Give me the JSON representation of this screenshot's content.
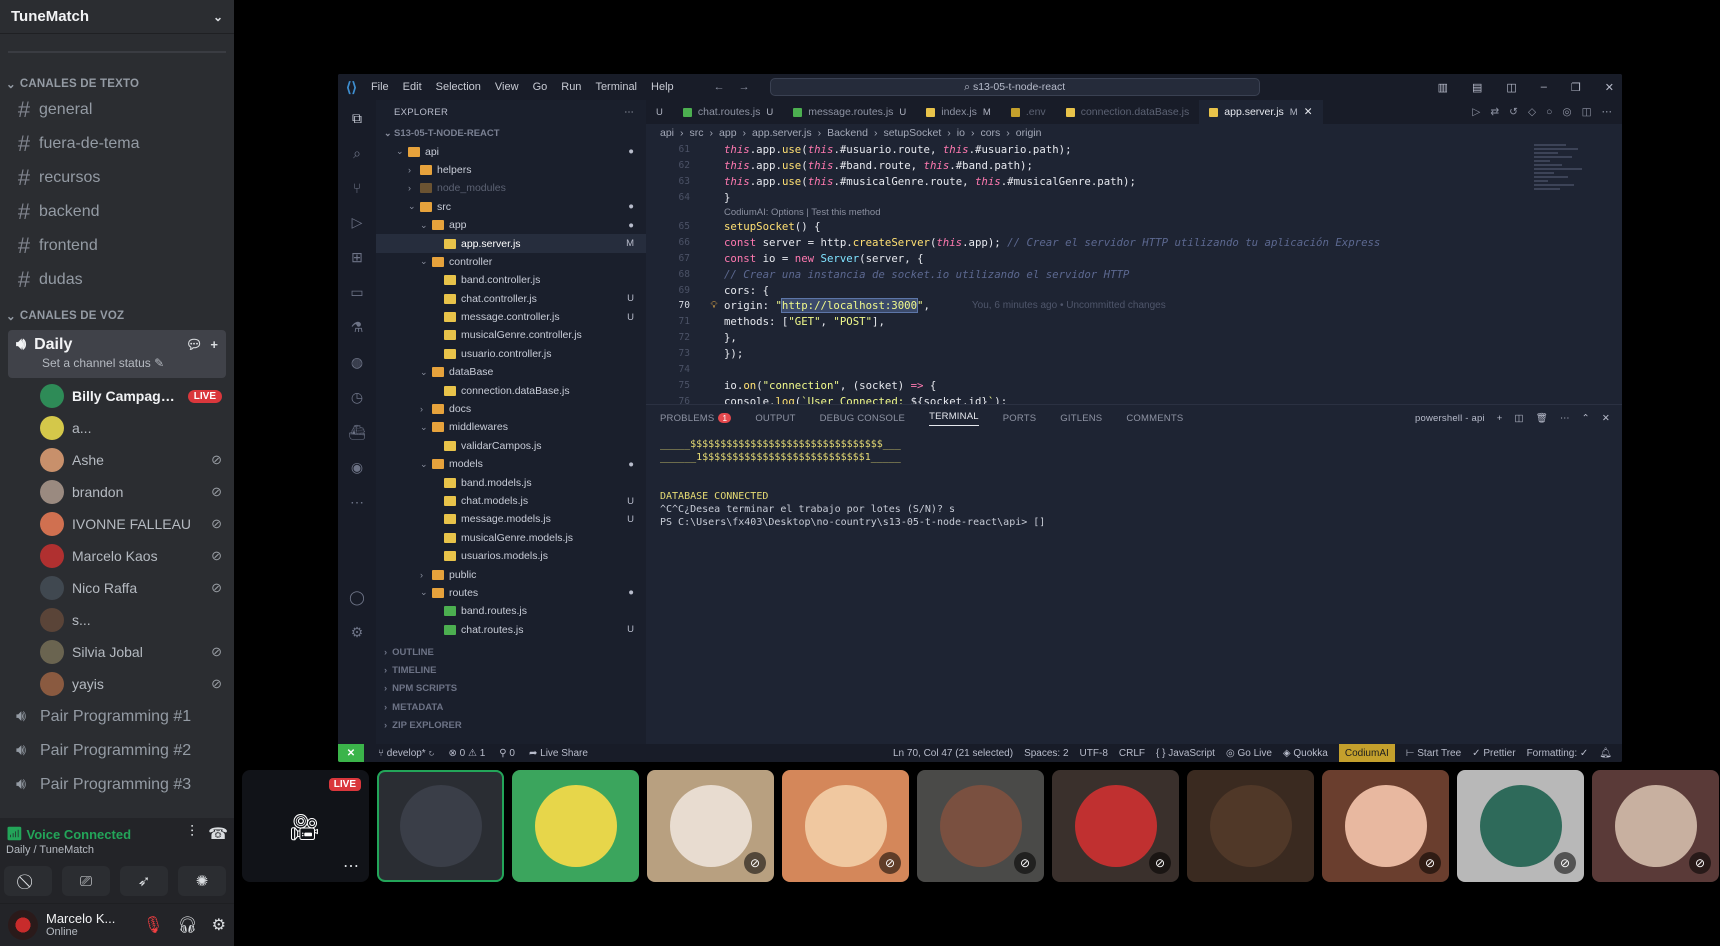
{
  "server": {
    "name": "TuneMatch"
  },
  "text_category": "CANALES DE TEXTO",
  "text_channels": [
    "general",
    "fuera-de-tema",
    "recursos",
    "backend",
    "frontend",
    "dudas"
  ],
  "voice_category": "CANALES DE VOZ",
  "active_voice": {
    "name": "Daily",
    "status": "Set a channel status"
  },
  "voice_members": [
    {
      "name": "Billy Campagno...",
      "live": "LIVE",
      "color": "#2e8b57"
    },
    {
      "name": "a...",
      "color": "#d4c84a"
    },
    {
      "name": "Ashe",
      "muted": true,
      "color": "#c8906b"
    },
    {
      "name": "brandon",
      "muted": true,
      "color": "#9a8a80"
    },
    {
      "name": "IVONNE FALLEAU",
      "muted": true,
      "color": "#d07050"
    },
    {
      "name": "Marcelo Kaos",
      "muted": true,
      "color": "#b03030"
    },
    {
      "name": "Nico Raffa",
      "muted": true,
      "color": "#404850"
    },
    {
      "name": "s...",
      "color": "#5a4438"
    },
    {
      "name": "Silvia Jobal",
      "muted": true,
      "color": "#6a6450"
    },
    {
      "name": "yayis",
      "muted": true,
      "color": "#8a5a40"
    }
  ],
  "other_voice": [
    "Pair Programming #1",
    "Pair Programming #2",
    "Pair Programming #3"
  ],
  "voice_panel": {
    "title": "Voice Connected",
    "subtitle": "Daily / TuneMatch"
  },
  "user": {
    "name": "Marcelo K...",
    "status": "Online"
  },
  "vscode": {
    "menu": [
      "File",
      "Edit",
      "Selection",
      "View",
      "Go",
      "Run",
      "Terminal",
      "Help"
    ],
    "search": "s13-05-t-node-react",
    "explorer_title": "EXPLORER",
    "project": "S13-05-T-NODE-REACT",
    "tree": [
      {
        "label": "api",
        "depth": 1,
        "type": "folder-open",
        "mark": "●"
      },
      {
        "label": "helpers",
        "depth": 2,
        "type": "folder"
      },
      {
        "label": "node_modules",
        "depth": 2,
        "type": "folder",
        "dim": true
      },
      {
        "label": "src",
        "depth": 2,
        "type": "folder-open",
        "mark": "●"
      },
      {
        "label": "app",
        "depth": 3,
        "type": "folder-open",
        "mark": "●"
      },
      {
        "label": "app.server.js",
        "depth": 4,
        "type": "js",
        "mark": "M",
        "sel": true
      },
      {
        "label": "controller",
        "depth": 3,
        "type": "folder-open"
      },
      {
        "label": "band.controller.js",
        "depth": 4,
        "type": "js"
      },
      {
        "label": "chat.controller.js",
        "depth": 4,
        "type": "js",
        "mark": "U"
      },
      {
        "label": "message.controller.js",
        "depth": 4,
        "type": "js",
        "mark": "U"
      },
      {
        "label": "musicalGenre.controller.js",
        "depth": 4,
        "type": "js"
      },
      {
        "label": "usuario.controller.js",
        "depth": 4,
        "type": "js"
      },
      {
        "label": "dataBase",
        "depth": 3,
        "type": "folder-open"
      },
      {
        "label": "connection.dataBase.js",
        "depth": 4,
        "type": "js"
      },
      {
        "label": "docs",
        "depth": 3,
        "type": "folder"
      },
      {
        "label": "middlewares",
        "depth": 3,
        "type": "folder-open"
      },
      {
        "label": "validarCampos.js",
        "depth": 4,
        "type": "js"
      },
      {
        "label": "models",
        "depth": 3,
        "type": "folder-open",
        "mark": "●"
      },
      {
        "label": "band.models.js",
        "depth": 4,
        "type": "js"
      },
      {
        "label": "chat.models.js",
        "depth": 4,
        "type": "js",
        "mark": "U"
      },
      {
        "label": "message.models.js",
        "depth": 4,
        "type": "js",
        "mark": "U"
      },
      {
        "label": "musicalGenre.models.js",
        "depth": 4,
        "type": "js"
      },
      {
        "label": "usuarios.models.js",
        "depth": 4,
        "type": "js"
      },
      {
        "label": "public",
        "depth": 3,
        "type": "folder"
      },
      {
        "label": "routes",
        "depth": 3,
        "type": "folder-open",
        "mark": "●"
      },
      {
        "label": "band.routes.js",
        "depth": 4,
        "type": "route"
      },
      {
        "label": "chat.routes.js",
        "depth": 4,
        "type": "route",
        "mark": "U"
      }
    ],
    "sections": [
      "OUTLINE",
      "TIMELINE",
      "NPM SCRIPTS",
      "METADATA",
      "ZIP EXPLORER"
    ],
    "tabs": [
      {
        "label": "U",
        "active": false
      },
      {
        "label": "chat.routes.js",
        "mark": "U"
      },
      {
        "label": "message.routes.js",
        "mark": "U"
      },
      {
        "label": "index.js",
        "mark": "M"
      },
      {
        "label": ".env"
      },
      {
        "label": "connection.dataBase.js"
      },
      {
        "label": "app.server.js",
        "mark": "M",
        "active": true
      }
    ],
    "breadcrumbs": [
      "api",
      "src",
      "app",
      "app.server.js",
      "Backend",
      "setupSocket",
      "io",
      "cors",
      "origin"
    ],
    "codelens": "CodiumAI: Options | Test this method",
    "blame": "You, 6 minutes ago • Uncommitted changes",
    "panel_tabs": [
      "PROBLEMS",
      "OUTPUT",
      "DEBUG CONSOLE",
      "TERMINAL",
      "PORTS",
      "GITLENS",
      "COMMENTS"
    ],
    "problems_count": "1",
    "terminal_name": "powershell - api",
    "terminal_lines": [
      "_____$$$$$$$$$$$$$$$$$$$$$$$$$$$$$$$$___",
      "______1$$$$$$$$$$$$$$$$$$$$$$$$$$$1_____",
      "",
      "",
      "DATABASE CONNECTED",
      "^C^C¿Desea terminar el trabajo por lotes (S/N)? s",
      "PS C:\\Users\\fx403\\Desktop\\no-country\\s13-05-t-node-react\\api> []"
    ],
    "status": {
      "branch": "develop*",
      "errors": "⊗ 0 ⚠ 1",
      "ports": "0",
      "liveshare": "Live Share",
      "position": "Ln 70, Col 47 (21 selected)",
      "spaces": "Spaces: 2",
      "encoding": "UTF-8",
      "eol": "CRLF",
      "lang": "{ } JavaScript",
      "golive": "Go Live",
      "quokka": "Quokka",
      "codium": "CodiumAI",
      "starttree": "Start Tree",
      "prettier": "✓ Prettier",
      "formatting": "Formatting: ✓"
    }
  },
  "tiles": [
    {
      "kind": "stream",
      "live": "LIVE"
    },
    {
      "kind": "avatar",
      "color": "#2a2d33",
      "face": "#3a3e48",
      "speaking": true
    },
    {
      "kind": "avatar",
      "color": "#3ba55d",
      "face": "#e7d64a"
    },
    {
      "kind": "avatar",
      "color": "#b8a080",
      "face": "#e8dcd0",
      "muted": true
    },
    {
      "kind": "avatar",
      "color": "#d4875a",
      "face": "#f0c8a0",
      "muted": true
    },
    {
      "kind": "avatar",
      "color": "#4a4a48",
      "face": "#7a5040",
      "muted": true
    },
    {
      "kind": "avatar",
      "color": "#3a302c",
      "face": "#c03030",
      "muted": true
    },
    {
      "kind": "avatar",
      "color": "#3a2a20",
      "face": "#503828"
    },
    {
      "kind": "avatar",
      "color": "#6a3e2e",
      "face": "#e8b8a0",
      "muted": true
    },
    {
      "kind": "avatar",
      "color": "#b8b8b8",
      "face": "#2e6a5a",
      "muted": true
    },
    {
      "kind": "avatar",
      "color": "#5a3a38",
      "face": "#c8b0a0",
      "muted": true
    }
  ],
  "colors": {
    "accent_green": "#23a559",
    "live_red": "#da373c",
    "discord_bg": "#2b2d31"
  }
}
